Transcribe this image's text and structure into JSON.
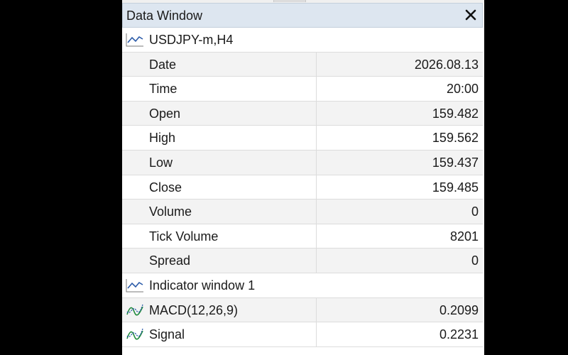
{
  "window": {
    "title": "Data Window"
  },
  "symbol": {
    "name": "USDJPY-m,H4",
    "icon": "line-chart-icon"
  },
  "fields": [
    {
      "label": "Date",
      "value": "2026.08.13"
    },
    {
      "label": "Time",
      "value": "20:00"
    },
    {
      "label": "Open",
      "value": "159.482"
    },
    {
      "label": "High",
      "value": "159.562"
    },
    {
      "label": "Low",
      "value": "159.437"
    },
    {
      "label": "Close",
      "value": "159.485"
    },
    {
      "label": "Volume",
      "value": "0"
    },
    {
      "label": "Tick Volume",
      "value": "8201"
    },
    {
      "label": "Spread",
      "value": "0"
    }
  ],
  "indicator_window": {
    "name": "Indicator window 1",
    "icon": "line-chart-icon"
  },
  "indicators": [
    {
      "label": "MACD(12,26,9)",
      "value": "0.2099",
      "icon": "indicator-wave-icon"
    },
    {
      "label": "Signal",
      "value": "0.2231",
      "icon": "indicator-wave-icon"
    }
  ],
  "colors": {
    "titlebar_bg": "#dde6f0",
    "row_shade": "#f3f3f3",
    "line_icon": "#2a5aa8",
    "indicator_icon": "#1e8a3a"
  }
}
